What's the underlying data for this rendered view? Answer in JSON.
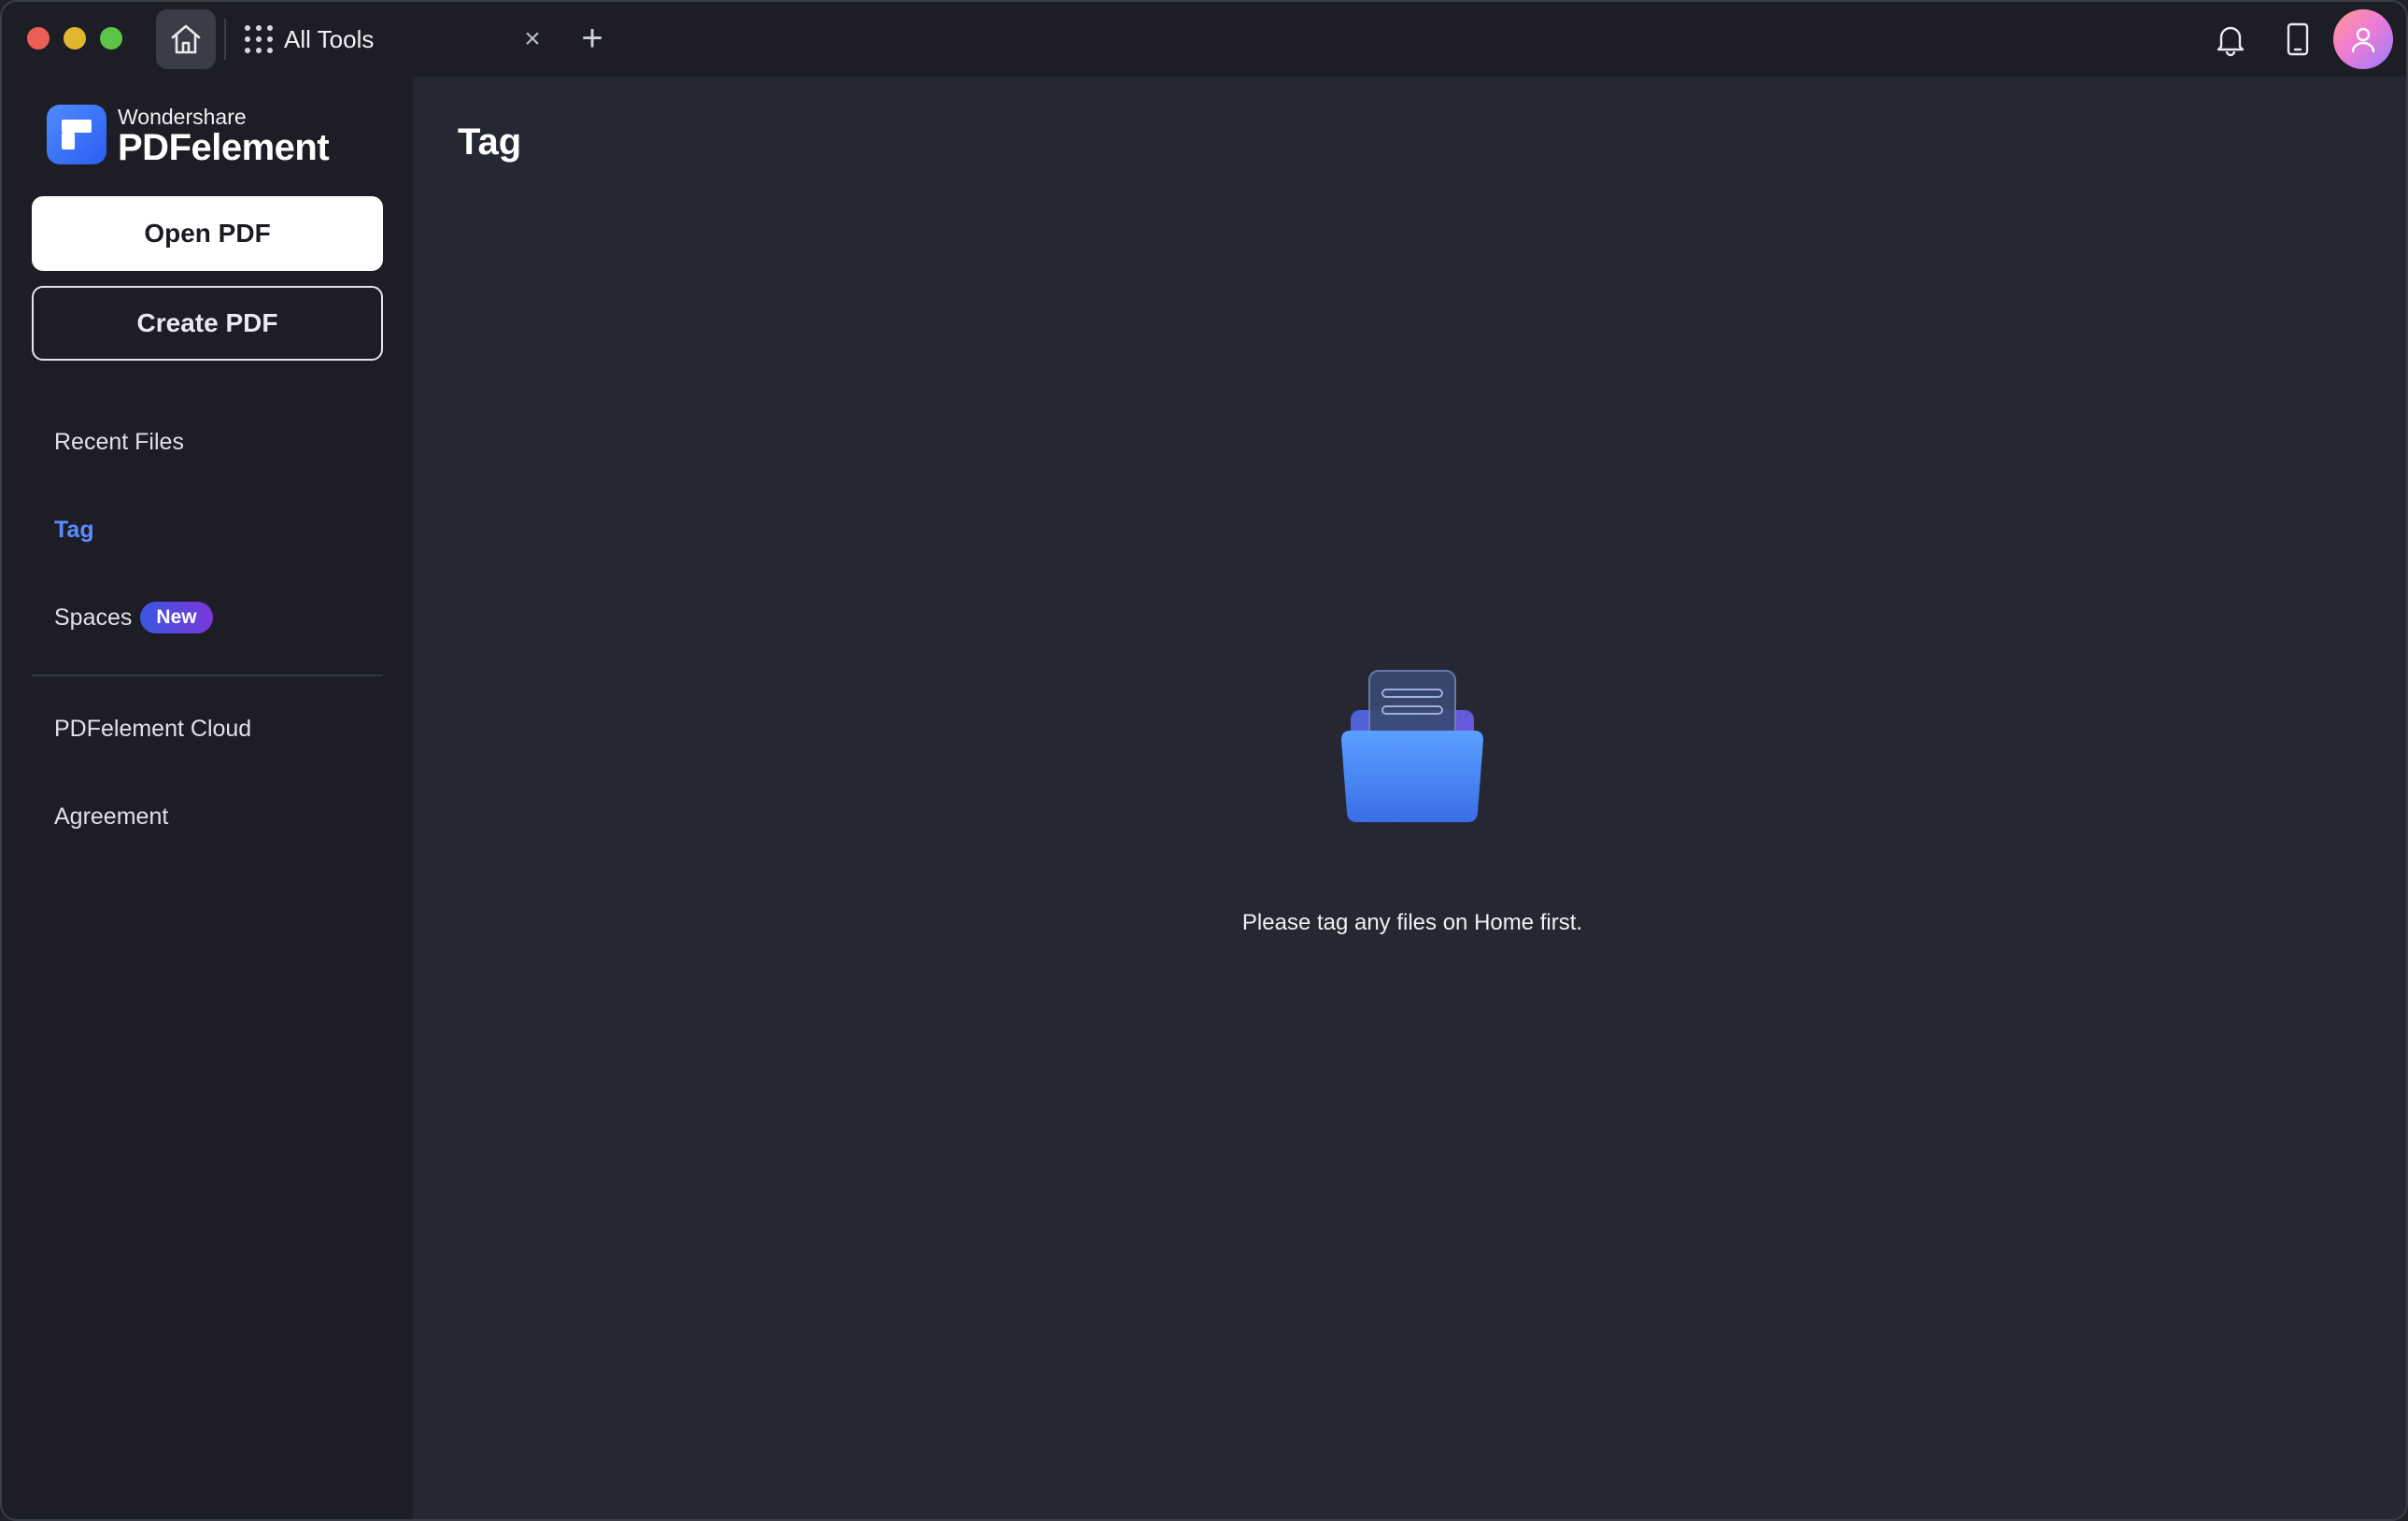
{
  "titlebar": {
    "tab_label": "All Tools",
    "tab_close": "×",
    "tab_add": "+"
  },
  "sidebar": {
    "brand_small": "Wondershare",
    "brand_big": "PDFelement",
    "open_pdf": "Open PDF",
    "create_pdf": "Create PDF",
    "items": [
      {
        "label": "Recent Files",
        "active": false
      },
      {
        "label": "Tag",
        "active": true
      },
      {
        "label": "Spaces",
        "active": false,
        "badge": "New"
      },
      {
        "label": "PDFelement Cloud",
        "active": false
      },
      {
        "label": "Agreement",
        "active": false
      }
    ]
  },
  "main": {
    "title": "Tag",
    "empty_message": "Please tag any files on Home first."
  },
  "colors": {
    "accent": "#5b8cff",
    "background": "#252733",
    "sidebar": "#1d1e25"
  },
  "icons": [
    "home-icon",
    "all-tools-grid-icon",
    "close-icon",
    "plus-icon",
    "bell-icon",
    "device-icon",
    "avatar-icon",
    "empty-folder-icon"
  ]
}
